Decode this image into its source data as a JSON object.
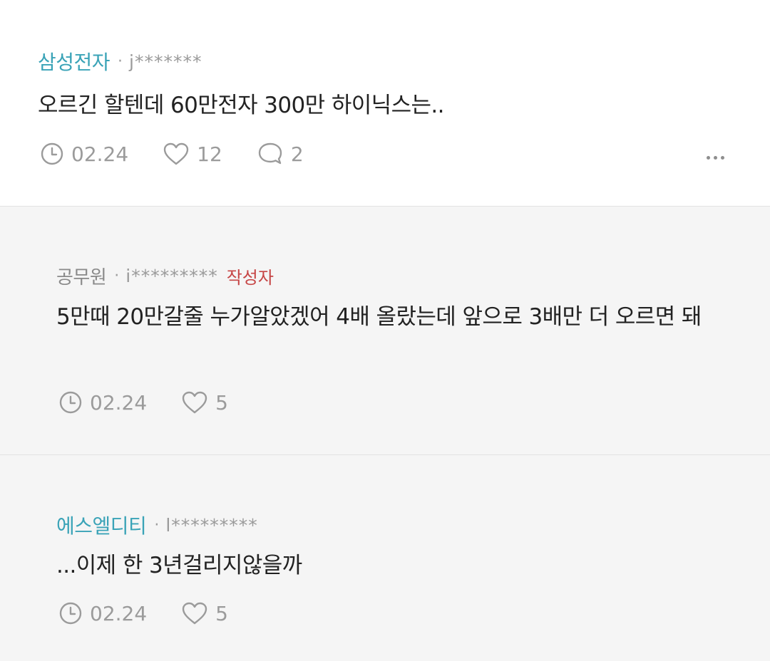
{
  "comments": [
    {
      "author": "삼성전자",
      "separator": "·",
      "user_id": "j*******",
      "text": "오르긴 할텐데 60만전자 300만 하이닉스는..",
      "date": "02.24",
      "likes": "12",
      "replies": "2"
    },
    {
      "author": "공무원",
      "separator": "·",
      "user_id": "i*********",
      "badge": "작성자",
      "text": "5만때 20만갈줄 누가알았겠어 4배 올랐는데 앞으로 3배만 더 오르면 돼",
      "date": "02.24",
      "likes": "5"
    },
    {
      "author": "에스엘디티",
      "separator": "·",
      "user_id": "l*********",
      "text": "...이제 한 3년걸리지않을까",
      "date": "02.24",
      "likes": "5"
    }
  ],
  "icons": {
    "clock": "clock-icon",
    "heart": "heart-icon",
    "reply": "speech-bubble-icon",
    "more": "more-horizontal-icon"
  },
  "colors": {
    "stock_author": "#3aa3b7",
    "badge": "#c64545",
    "meta": "#9b9b9b"
  }
}
